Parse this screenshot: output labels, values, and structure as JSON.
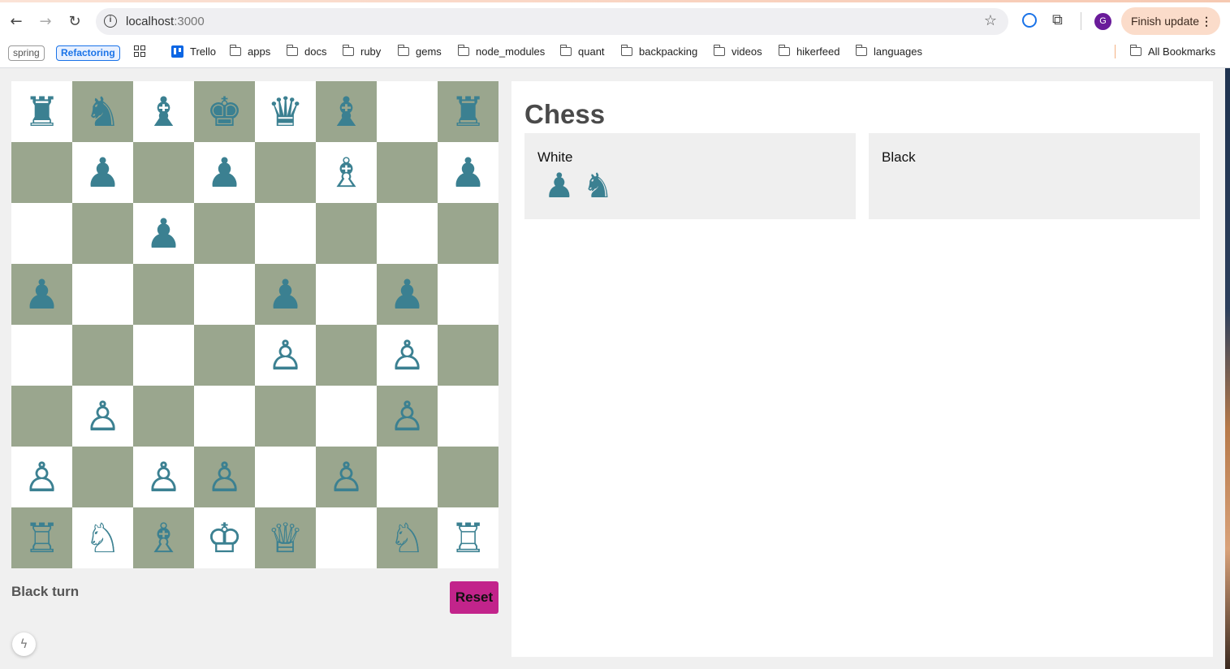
{
  "browser": {
    "url_host": "localhost",
    "url_port": ":3000",
    "finish_update_label": "Finish update",
    "avatar_letter": "G",
    "bookmarks": {
      "tag1": "spring",
      "tag2": "Refactoring",
      "trello": "Trello",
      "folders": [
        "apps",
        "docs",
        "ruby",
        "gems",
        "node_modules",
        "quant",
        "backpacking",
        "videos",
        "hikerfeed",
        "languages"
      ],
      "all_bookmarks": "All Bookmarks"
    }
  },
  "game": {
    "title": "Chess",
    "turn_text": "Black turn",
    "reset_label": "Reset",
    "board": [
      [
        "bR",
        "bN",
        "bB",
        "bK",
        "bQ",
        "bB",
        "",
        "bR"
      ],
      [
        "",
        "bP",
        "",
        "bP",
        "",
        "wB",
        "",
        "bP"
      ],
      [
        "",
        "",
        "bP",
        "",
        "",
        "",
        "",
        ""
      ],
      [
        "bP",
        "",
        "",
        "",
        "bP",
        "",
        "bP",
        ""
      ],
      [
        "",
        "",
        "",
        "",
        "wP",
        "",
        "wP",
        ""
      ],
      [
        "",
        "wP",
        "",
        "",
        "",
        "",
        "wP",
        ""
      ],
      [
        "wP",
        "",
        "wP",
        "wP",
        "",
        "wP",
        "",
        ""
      ],
      [
        "wR",
        "wN",
        "wB",
        "wK",
        "wQ",
        "",
        "wN",
        "wR"
      ]
    ],
    "captured": {
      "white_label": "White",
      "white_pieces": [
        "bP",
        "bN"
      ],
      "black_label": "Black",
      "black_pieces": []
    }
  },
  "colors": {
    "light_square": "#ffffff",
    "dark_square": "#9aa68e",
    "piece": "#3b8091",
    "reset_button": "#c2248b"
  },
  "icons": {
    "back": "back-arrow-icon",
    "forward": "forward-arrow-icon",
    "reload": "reload-icon",
    "info": "site-info-icon",
    "star": "bookmark-star-icon",
    "extensions": "puzzle-icon",
    "dev_tools": "lightning-icon"
  }
}
